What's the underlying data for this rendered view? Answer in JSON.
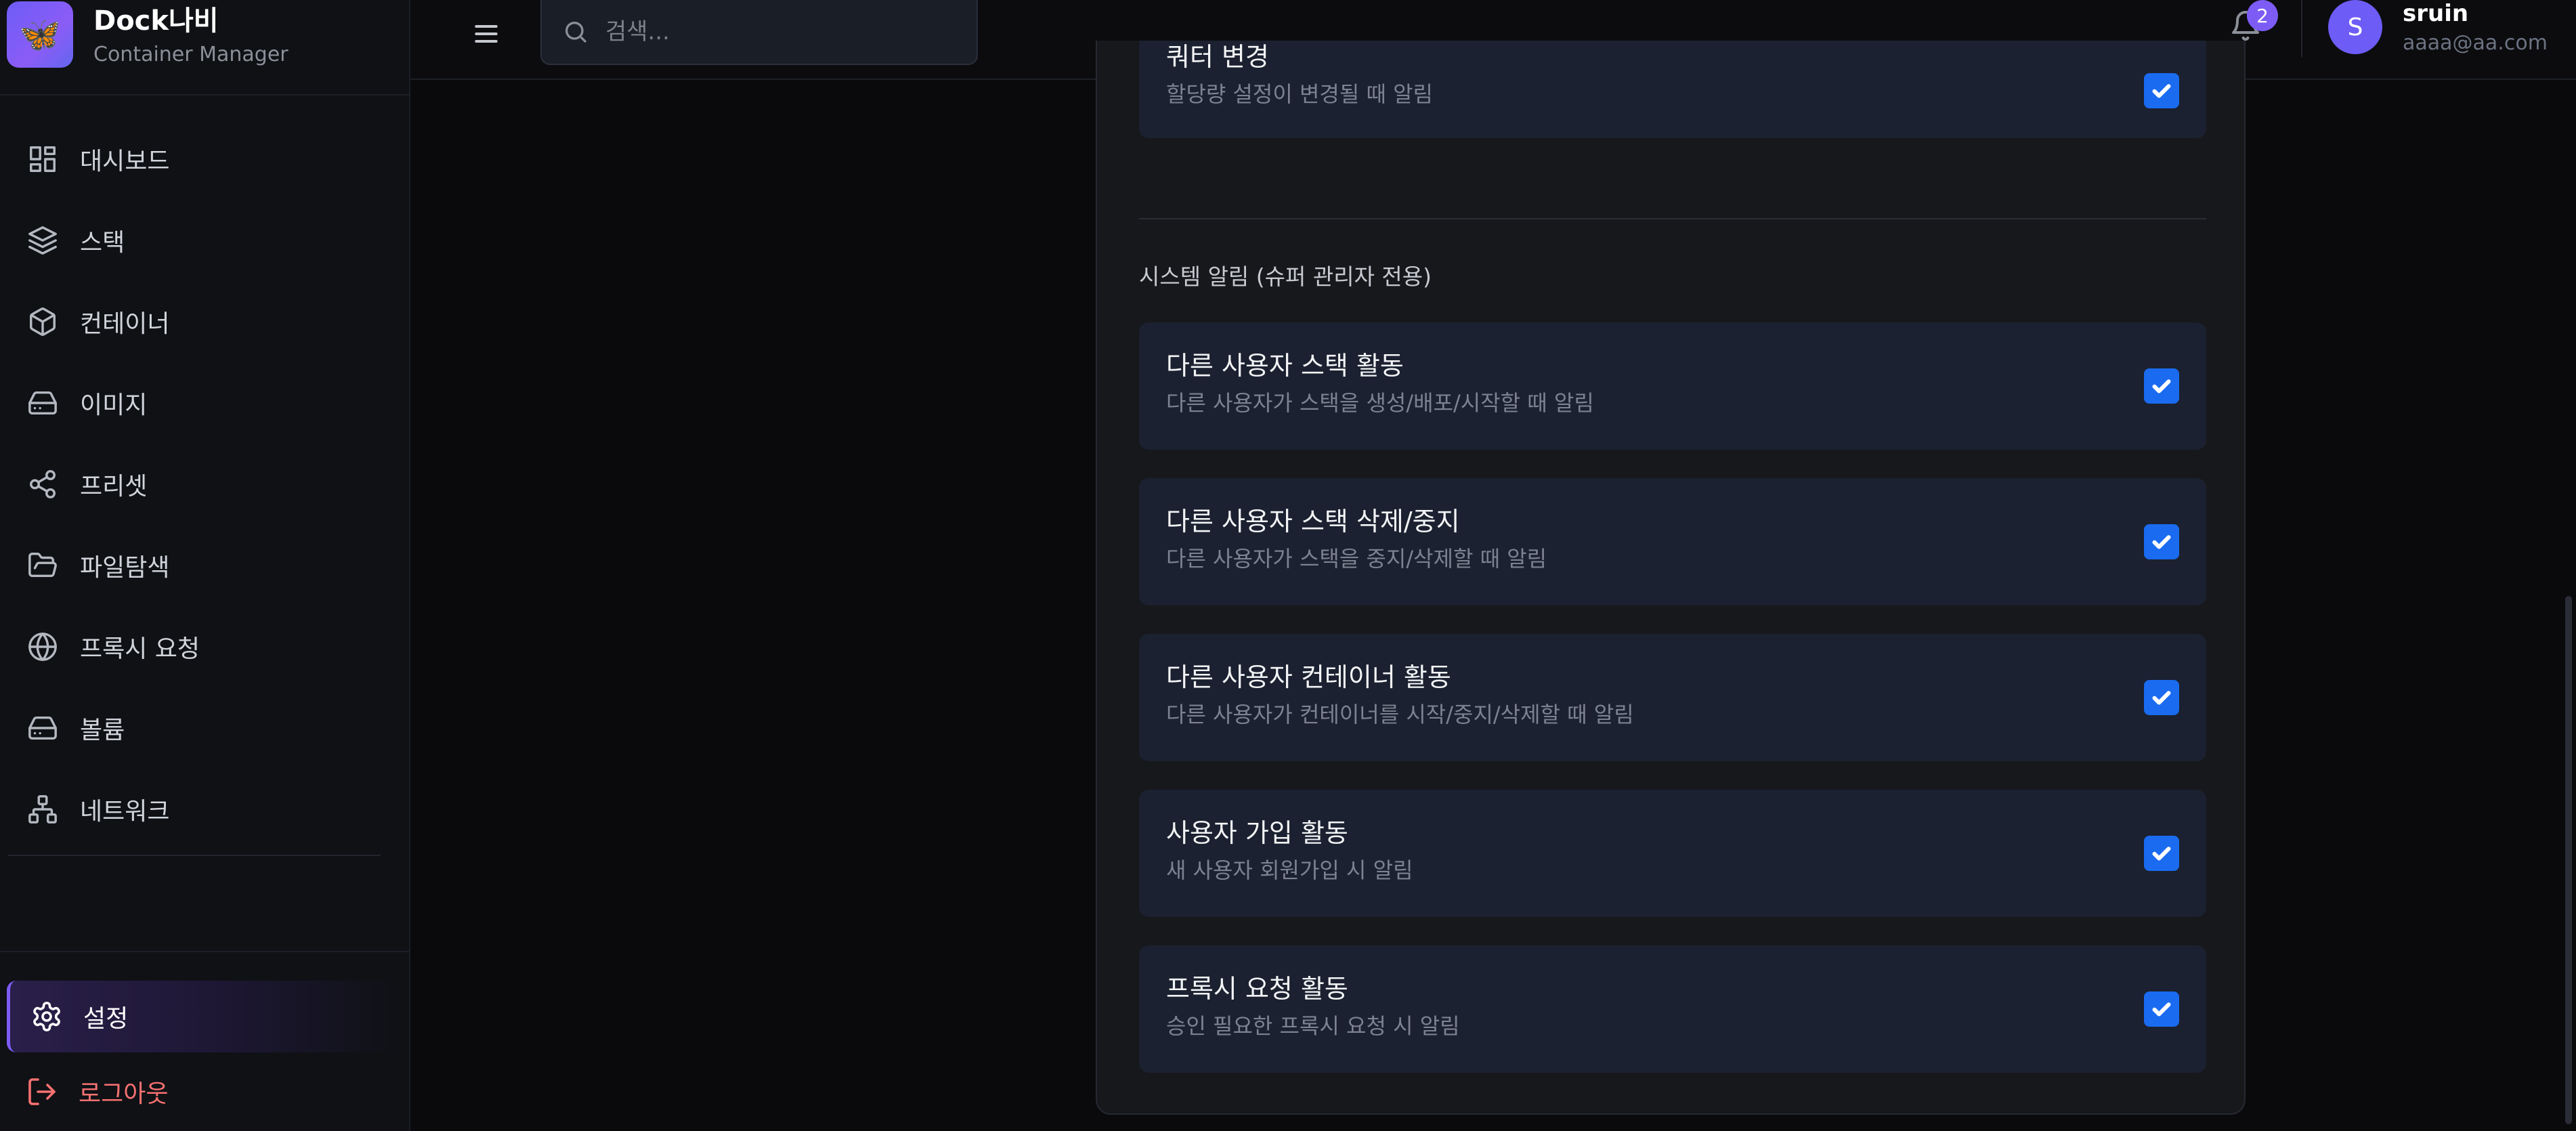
{
  "brand": {
    "logo": "🦋",
    "title": "Dock나비",
    "subtitle": "Container Manager"
  },
  "sidebar": {
    "items": [
      {
        "label": "대시보드",
        "icon": "dashboard-icon"
      },
      {
        "label": "스택",
        "icon": "layers-icon"
      },
      {
        "label": "컨테이너",
        "icon": "box-icon"
      },
      {
        "label": "이미지",
        "icon": "hard-drive-icon"
      },
      {
        "label": "프리셋",
        "icon": "share-icon"
      },
      {
        "label": "파일탐색",
        "icon": "folder-open-icon"
      },
      {
        "label": "프록시 요청",
        "icon": "globe-icon"
      },
      {
        "label": "볼륨",
        "icon": "hard-drive-icon"
      },
      {
        "label": "네트워크",
        "icon": "network-icon"
      }
    ],
    "settings_label": "설정",
    "logout_label": "로그아웃"
  },
  "topbar": {
    "search_placeholder": "검색...",
    "notification_count": "2",
    "user": {
      "initial": "S",
      "name": "sruin",
      "email": "aaaa@aa.com"
    }
  },
  "main": {
    "top_card": {
      "title": "쿼터 변경",
      "desc": "할당량 설정이 변경될 때 알림",
      "checked": true
    },
    "system_section_title": "시스템 알림 (슈퍼 관리자 전용)",
    "system_cards": [
      {
        "title": "다른 사용자 스택 활동",
        "desc": "다른 사용자가 스택을 생성/배포/시작할 때 알림",
        "checked": true
      },
      {
        "title": "다른 사용자 스택 삭제/중지",
        "desc": "다른 사용자가 스택을 중지/삭제할 때 알림",
        "checked": true
      },
      {
        "title": "다른 사용자 컨테이너 활동",
        "desc": "다른 사용자가 컨테이너를 시작/중지/삭제할 때 알림",
        "checked": true
      },
      {
        "title": "사용자 가입 활동",
        "desc": "새 사용자 회원가입 시 알림",
        "checked": true
      },
      {
        "title": "프록시 요청 활동",
        "desc": "승인 필요한 프록시 요청 시 알림",
        "checked": true
      }
    ]
  },
  "colors": {
    "accent": "#7c5cf5",
    "checkbox": "#1a6bf0",
    "logout": "#f87171",
    "card_bg": "#1b2130"
  }
}
